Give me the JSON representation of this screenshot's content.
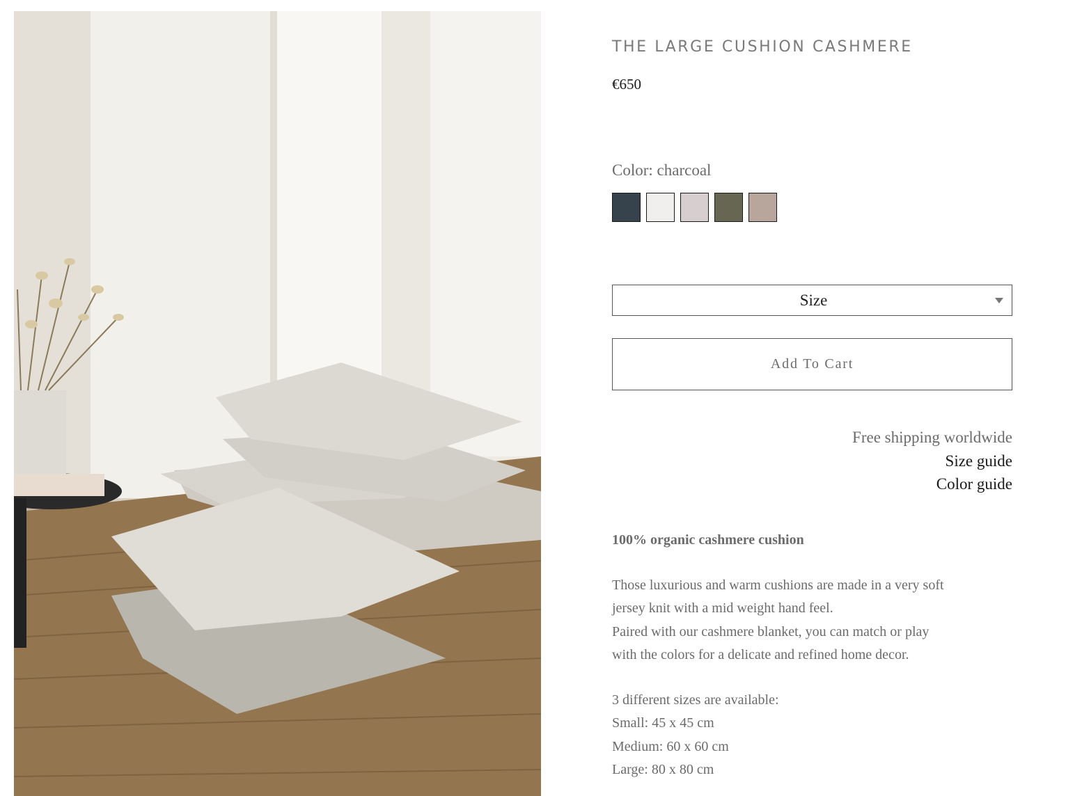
{
  "product": {
    "title": "THE LARGE CUSHION CASHMERE",
    "price": "€650",
    "color_label": "Color: charcoal",
    "swatches": [
      {
        "name": "charcoal",
        "color": "#36424c"
      },
      {
        "name": "white",
        "color": "#f1efed"
      },
      {
        "name": "light grey",
        "color": "#d6cecf"
      },
      {
        "name": "olive",
        "color": "#666653"
      },
      {
        "name": "taupe",
        "color": "#b8a69c"
      }
    ],
    "size_select_label": "Size",
    "add_to_cart_label": "Add To Cart"
  },
  "info": {
    "shipping": "Free shipping worldwide",
    "size_guide": "Size guide",
    "color_guide": "Color guide"
  },
  "description": {
    "heading": "100% organic cashmere cushion",
    "line1": "Those luxurious and warm cushions are made in a very soft",
    "line2": "jersey knit with a mid weight hand feel.",
    "line3": "Paired with our cashmere blanket, you can match or play",
    "line4": "with the colors for a delicate and refined home decor.",
    "sizes_intro": "3 different sizes are available:",
    "size_small": "Small: 45 x 45 cm",
    "size_medium": "Medium: 60 x 60 cm",
    "size_large": "Large: 80 x 80 cm"
  }
}
